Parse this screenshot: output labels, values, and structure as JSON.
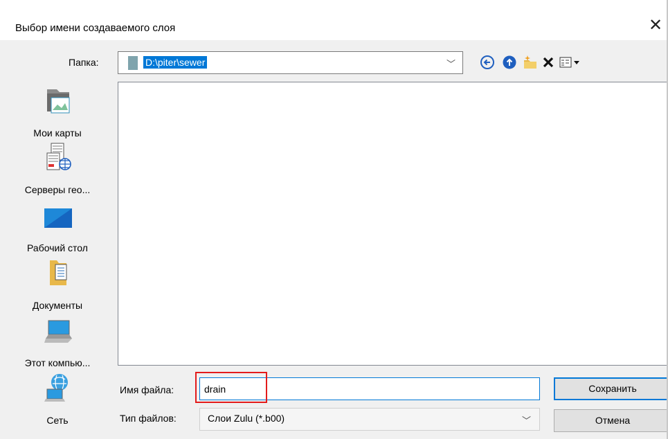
{
  "window": {
    "title": "Выбор имени создаваемого слоя",
    "close_glyph": "✕"
  },
  "folder": {
    "label": "Папка:",
    "value": "D:\\piter\\sewer"
  },
  "toolbar": {
    "icons": [
      "back-icon",
      "up-folder-icon",
      "new-folder-icon",
      "delete-icon",
      "view-menu-icon"
    ]
  },
  "places": [
    {
      "label": "Мои карты",
      "icon": "my-maps-icon"
    },
    {
      "label": "Серверы гео...",
      "icon": "geo-servers-icon"
    },
    {
      "label": "Рабочий стол",
      "icon": "desktop-icon"
    },
    {
      "label": "Документы",
      "icon": "documents-icon"
    },
    {
      "label": "Этот компью...",
      "icon": "this-pc-icon"
    },
    {
      "label": "Сеть",
      "icon": "network-icon"
    }
  ],
  "filename": {
    "label": "Имя файла:",
    "value": "drain"
  },
  "filetype": {
    "label": "Тип файлов:",
    "value": "Слои Zulu (*.b00)"
  },
  "buttons": {
    "save": "Сохранить",
    "cancel": "Отмена"
  },
  "colors": {
    "accent": "#0078d7",
    "highlight": "#e31b1b"
  }
}
